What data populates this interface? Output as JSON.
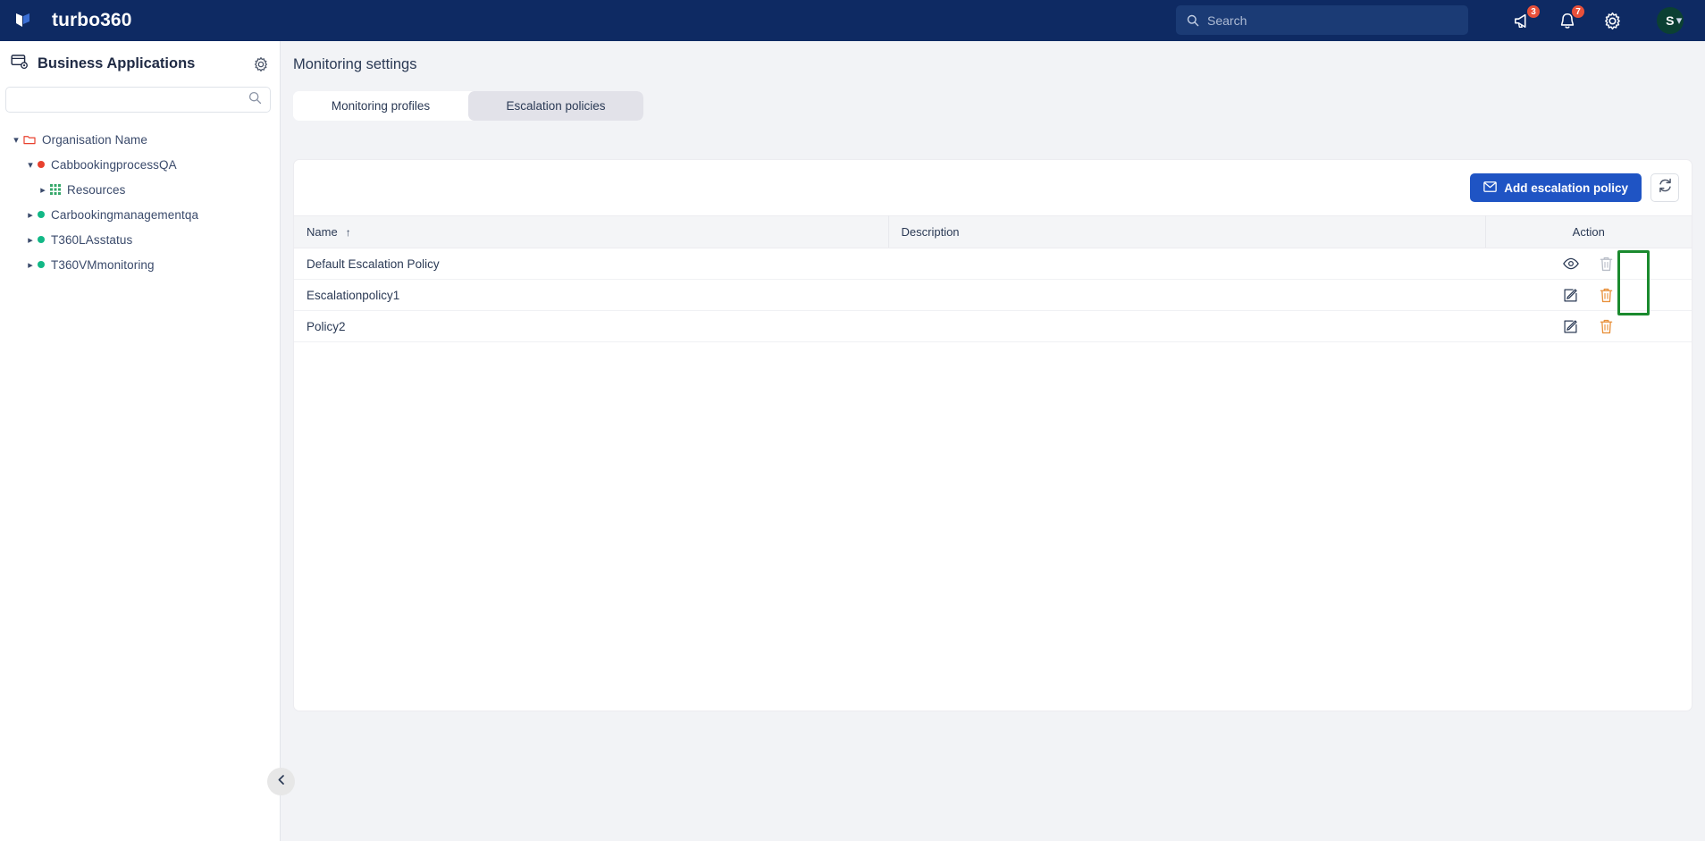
{
  "topbar": {
    "brand": "turbo360",
    "search_placeholder": "Search",
    "search_value": "",
    "announcements_badge": "3",
    "notifications_badge": "7",
    "avatar_initial": "S"
  },
  "sidebar": {
    "title": "Business Applications",
    "search_placeholder": "",
    "search_value": "",
    "tree": [
      {
        "label": "Organisation Name",
        "icon": "folder-icon",
        "indent": 0,
        "expanded": true,
        "dot": null
      },
      {
        "label": "CabbookingprocessQA",
        "icon": "status-dot",
        "indent": 1,
        "expanded": true,
        "dot": "#e8412e"
      },
      {
        "label": "Resources",
        "icon": "grid-icon",
        "indent": 2,
        "expanded": false,
        "dot": null
      },
      {
        "label": "Carbookingmanagementqa",
        "icon": "status-dot",
        "indent": 1,
        "expanded": false,
        "dot": "#12b886"
      },
      {
        "label": "T360LAsstatus",
        "icon": "status-dot",
        "indent": 1,
        "expanded": false,
        "dot": "#12b886"
      },
      {
        "label": "T360VMmonitoring",
        "icon": "status-dot",
        "indent": 1,
        "expanded": false,
        "dot": "#12b886"
      }
    ]
  },
  "main": {
    "page_title": "Monitoring settings",
    "tabs": [
      {
        "label": "Monitoring profiles",
        "active": false
      },
      {
        "label": "Escalation policies",
        "active": true
      }
    ],
    "toolbar": {
      "add_label": "Add escalation policy",
      "refresh_label": "Refresh"
    },
    "table": {
      "columns": [
        "Name",
        "Description",
        "Action"
      ],
      "sort_column": "Name",
      "sort_direction": "asc",
      "rows": [
        {
          "name": "Default Escalation Policy",
          "description": "",
          "actions": [
            "view-icon",
            "delete-icon-disabled"
          ]
        },
        {
          "name": "Escalationpolicy1",
          "description": "",
          "actions": [
            "edit-icon",
            "delete-icon"
          ]
        },
        {
          "name": "Policy2",
          "description": "",
          "actions": [
            "edit-icon",
            "delete-icon"
          ]
        }
      ]
    }
  },
  "colors": {
    "brand_navy": "#0e2a63",
    "primary_blue": "#1f54c4",
    "status_red": "#e8412e",
    "status_green": "#12b886",
    "highlight_green": "#1a8a2e",
    "delete_orange": "#e8903a"
  }
}
